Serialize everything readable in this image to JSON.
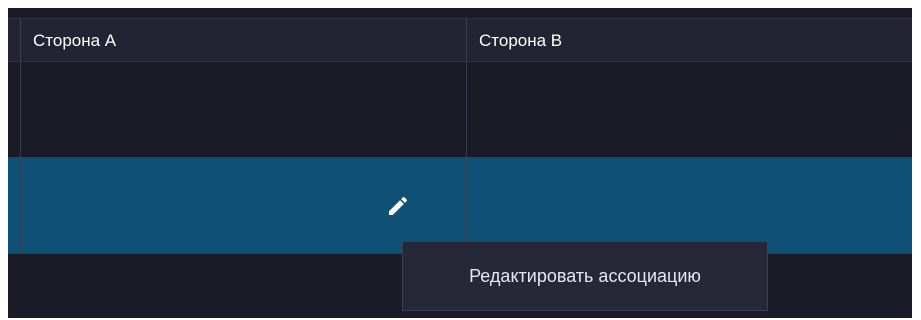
{
  "table": {
    "columns": [
      {
        "label": "Сторона A"
      },
      {
        "label": "Сторона B"
      }
    ],
    "rows": [
      {
        "side_a": "",
        "side_b": ""
      },
      {
        "side_a": "",
        "side_b": "",
        "selected": true
      }
    ]
  },
  "row_actions": {
    "edit_icon": "pencil-icon"
  },
  "tooltip": {
    "text": "Редактировать ассоциацию"
  },
  "colors": {
    "background": "#1b1c27",
    "header_bg": "#232433",
    "selected_row": "#0f5076",
    "tooltip_bg": "#262838",
    "border": "#3a3c50"
  }
}
